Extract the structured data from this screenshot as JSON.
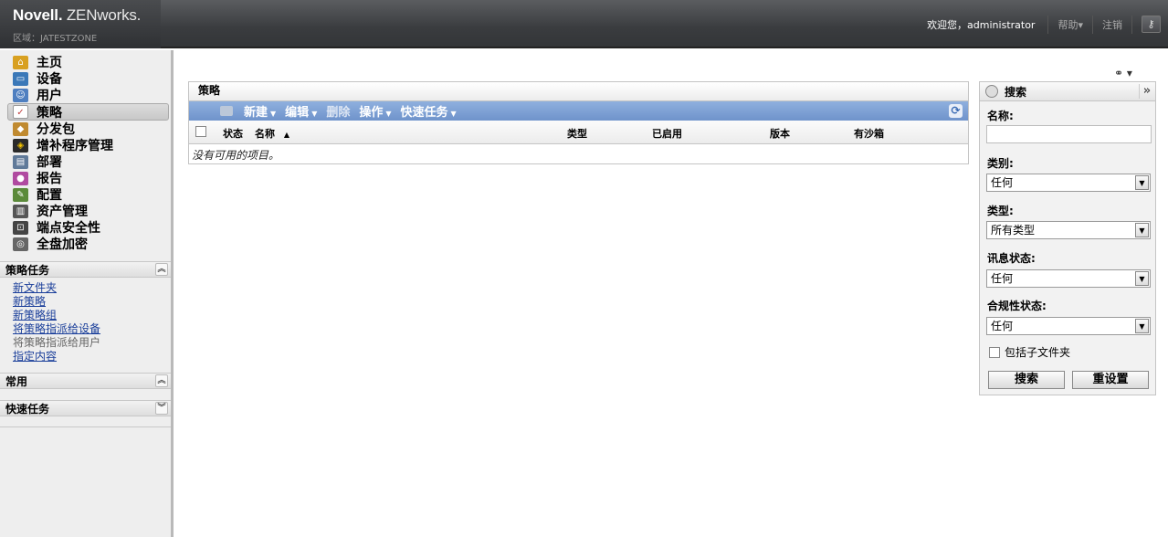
{
  "header": {
    "logo_brand": "Novell.",
    "logo_product": "ZENworks.",
    "zone": "区域：JATESTZONE",
    "welcome": "欢迎您，administrator",
    "help": "帮助▾",
    "logout": "注销",
    "tools_icon": "key-icon"
  },
  "sidebar": {
    "nav": [
      {
        "label": "主页",
        "icon": "home-icon",
        "color": "#d8a020"
      },
      {
        "label": "设备",
        "icon": "monitor-icon",
        "color": "#3a78b8"
      },
      {
        "label": "用户",
        "icon": "users-icon",
        "color": "#4f7fc0"
      },
      {
        "label": "策略",
        "icon": "policy-icon",
        "color": "#c04040"
      },
      {
        "label": "分发包",
        "icon": "bundle-icon",
        "color": "#c08a30"
      },
      {
        "label": "增补程序管理",
        "icon": "patch-shield-icon",
        "color": "#2a2a2a"
      },
      {
        "label": "部署",
        "icon": "deploy-icon",
        "color": "#607a99"
      },
      {
        "label": "报告",
        "icon": "report-icon",
        "color": "#b04aa0"
      },
      {
        "label": "配置",
        "icon": "wrench-icon",
        "color": "#5b8a3a"
      },
      {
        "label": "资产管理",
        "icon": "asset-icon",
        "color": "#555555"
      },
      {
        "label": "端点安全性",
        "icon": "lock-icon",
        "color": "#444444"
      },
      {
        "label": "全盘加密",
        "icon": "disk-encrypt-icon",
        "color": "#666666"
      }
    ],
    "policy_tasks": {
      "title": "策略任务",
      "links": [
        {
          "label": "新文件夹",
          "enabled": true
        },
        {
          "label": "新策略",
          "enabled": true
        },
        {
          "label": "新策略组",
          "enabled": true
        },
        {
          "label": "将策略指派给设备",
          "enabled": true
        },
        {
          "label": "将策略指派给用户",
          "enabled": false
        },
        {
          "label": "指定内容",
          "enabled": true
        }
      ]
    },
    "common": {
      "title": "常用"
    },
    "quick_tasks": {
      "title": "快速任务"
    }
  },
  "policies": {
    "title": "策略",
    "toolbar": {
      "new": "新建",
      "edit": "编辑",
      "delete": "删除",
      "actions": "操作",
      "quick_tasks": "快速任务"
    },
    "columns": {
      "status": "状态",
      "name": "名称",
      "sort_indicator": "▲",
      "type": "类型",
      "enabled": "已启用",
      "version": "版本",
      "sandbox": "有沙箱"
    },
    "empty_message": "没有可用的项目。"
  },
  "search": {
    "title": "搜索",
    "name_label": "名称:",
    "name_value": "",
    "category_label": "类别:",
    "category_value": "任何",
    "type_label": "类型:",
    "type_value": "所有类型",
    "message_status_label": "讯息状态:",
    "message_status_value": "任何",
    "compliance_label": "合规性状态:",
    "compliance_value": "任何",
    "include_subfolders": "包括子文件夹",
    "include_subfolders_checked": false,
    "search_button": "搜索",
    "reset_button": "重设置"
  }
}
